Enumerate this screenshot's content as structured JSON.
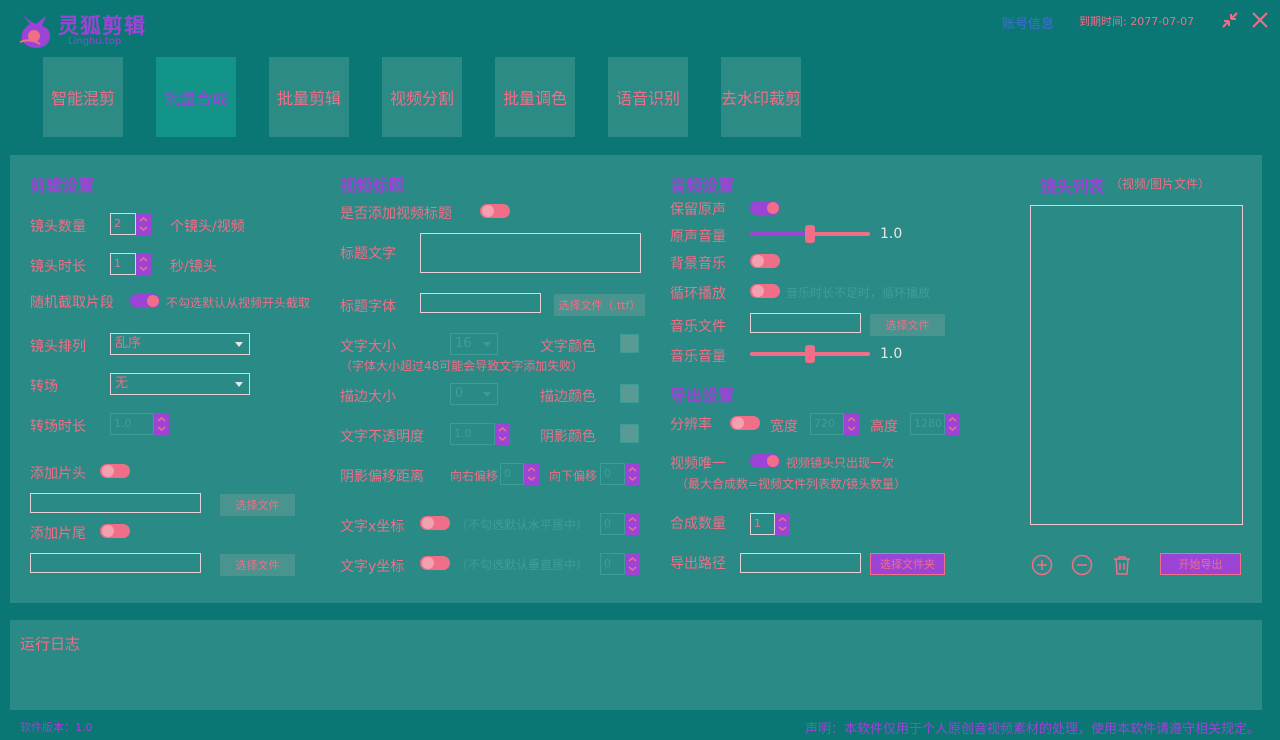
{
  "header": {
    "app_name": "灵狐剪辑",
    "app_url": "Linghu.top",
    "account_link": "账号信息",
    "expire_label": "到期时间: ",
    "expire_date": "2077-07-07",
    "icons": {
      "shrink": "shrink-icon",
      "close": "close-icon"
    }
  },
  "tabs": [
    {
      "label": "智能混剪",
      "active": false
    },
    {
      "label": "批量合成",
      "active": true
    },
    {
      "label": "批量剪辑",
      "active": false
    },
    {
      "label": "视频分割",
      "active": false
    },
    {
      "label": "批量调色",
      "active": false
    },
    {
      "label": "语音识别",
      "active": false
    },
    {
      "label": "去水印裁剪",
      "active": false
    }
  ],
  "edit": {
    "title": "剪辑设置",
    "shot_count_label": "镜头数量",
    "shot_count_value": "2",
    "shot_count_unit": "个镜头/视频",
    "shot_duration_label": "镜头时长",
    "shot_duration_value": "1",
    "shot_duration_unit": "秒/镜头",
    "random_clip_label": "随机截取片段",
    "random_clip_hint": "不勾选默认从视频开头截取",
    "order_label": "镜头排列",
    "order_value": "乱序",
    "transition_label": "转场",
    "transition_value": "无",
    "transition_duration_label": "转场时长",
    "transition_duration_value": "1.0",
    "intro_label": "添加片头",
    "intro_button": "选择文件",
    "outro_label": "添加片尾",
    "outro_button": "选择文件"
  },
  "title_settings": {
    "title": "视频标题",
    "add_title_label": "是否添加视频标题",
    "title_text_label": "标题文字",
    "title_font_label": "标题字体",
    "title_font_button": "选择文件（.ttf）",
    "font_size_label": "文字大小",
    "font_size_value": "16",
    "text_color_label": "文字颜色",
    "font_size_note": "（字体大小超过48可能会导致文字添加失败）",
    "stroke_size_label": "描边大小",
    "stroke_size_value": "0",
    "stroke_color_label": "描边颜色",
    "opacity_label": "文字不透明度",
    "opacity_value": "1.0",
    "shadow_color_label": "阴影颜色",
    "shadow_offset_label": "阴影偏移距离",
    "offset_right_label": "向右偏移",
    "offset_right_value": "0",
    "offset_down_label": "向下偏移",
    "offset_down_value": "0",
    "x_label": "文字x坐标",
    "x_hint": "（不勾选默认水平居中）",
    "x_value": "0",
    "y_label": "文字y坐标",
    "y_hint": "（不勾选默认垂直居中）",
    "y_value": "0"
  },
  "audio": {
    "title": "音频设置",
    "keep_original_label": "保留原声",
    "original_volume_label": "原声音量",
    "original_volume_value": "1.0",
    "original_volume_level": 0.5,
    "bgm_label": "背景音乐",
    "loop_label": "循环播放",
    "loop_hint": "音乐时长不足时，循环播放",
    "music_file_label": "音乐文件",
    "music_file_button": "选择文件",
    "music_volume_label": "音乐音量",
    "music_volume_value": "1.0",
    "music_volume_level": 0.5
  },
  "export": {
    "title": "导出设置",
    "resolution_label": "分辨率",
    "width_label": "宽度",
    "width_value": "720",
    "height_label": "高度",
    "height_value": "1280",
    "unique_label": "视频唯一",
    "unique_hint": "视频镜头只出现一次",
    "unique_note": "（最大合成数=视频文件列表数/镜头数量）",
    "count_label": "合成数量",
    "count_value": "1",
    "path_label": "导出路径",
    "path_button": "选择文件夹"
  },
  "shots": {
    "title": "镜头列表",
    "subtitle": "（视频/图片文件）",
    "start_button": "开始导出",
    "icons": {
      "add": "add-circle-icon",
      "remove": "remove-circle-icon",
      "delete": "trash-icon"
    }
  },
  "log": {
    "title": "运行日志"
  },
  "footer": {
    "version": "软件版本：1.0",
    "disclaimer": "声明：本软件仅用于个人原创音视频素材的处理，使用本软件请遵守相关规定。"
  }
}
